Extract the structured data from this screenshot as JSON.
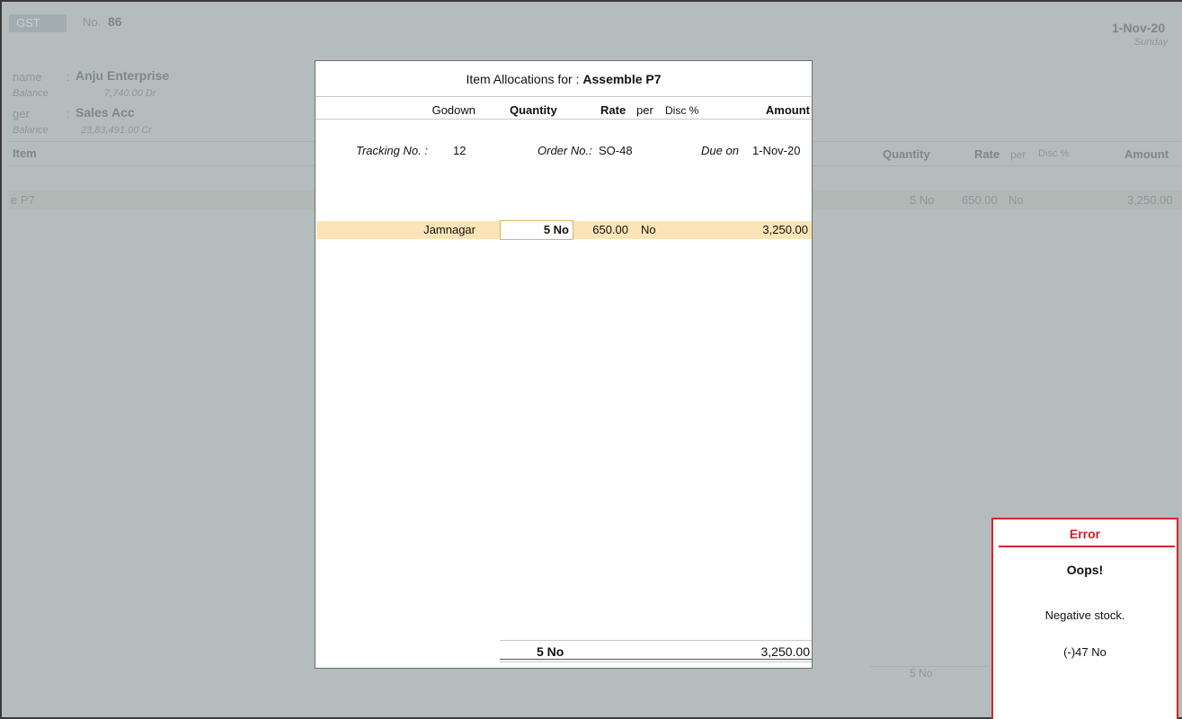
{
  "background": {
    "voucher_type": "GST",
    "no_label": "No.",
    "voucher_no": "86",
    "date": "1-Nov-20",
    "day": "Sunday",
    "party_label": "name",
    "party_sep": ":",
    "party_value": "Anju Enterprise",
    "balance_label_1": "Balance",
    "balance_value_1": "7,740.00 Dr",
    "ledger_label": "ger",
    "ledger_sep": ":",
    "ledger_value": "Sales Acc",
    "balance_label_2": "Balance",
    "balance_value_2": "23,83,491.00 Cr",
    "item_header": "Item",
    "col_quantity": "Quantity",
    "col_rate": "Rate",
    "col_per": "per",
    "col_disc": "Disc %",
    "col_amount": "Amount",
    "row_item": "e P7",
    "row_qty": "5 No",
    "row_rate": "650.00",
    "row_per": "No",
    "row_amount": "3,250.00",
    "total_qty": "5 No"
  },
  "popup": {
    "title_prefix": "Item Allocations for : ",
    "title_item": "Assemble P7",
    "headers": {
      "godown": "Godown",
      "quantity": "Quantity",
      "rate": "Rate",
      "per": "per",
      "disc": "Disc %",
      "amount": "Amount"
    },
    "tracking_label": "Tracking No. :",
    "tracking_value": "12",
    "order_label": "Order No.:",
    "order_value": "SO-48",
    "due_label": "Due on",
    "due_value": "1-Nov-20",
    "row": {
      "godown": "Jamnagar",
      "quantity": "5 No",
      "rate": "650.00",
      "per": "No",
      "amount": "3,250.00"
    },
    "total_quantity": "5 No",
    "total_amount": "3,250.00"
  },
  "error": {
    "title": "Error",
    "heading": "Oops!",
    "message": "Negative stock.",
    "detail": "(-)47 No"
  },
  "colors": {
    "background": "#b4bcbe",
    "selected_row": "#fce4b6",
    "error_accent": "#d6262c"
  }
}
